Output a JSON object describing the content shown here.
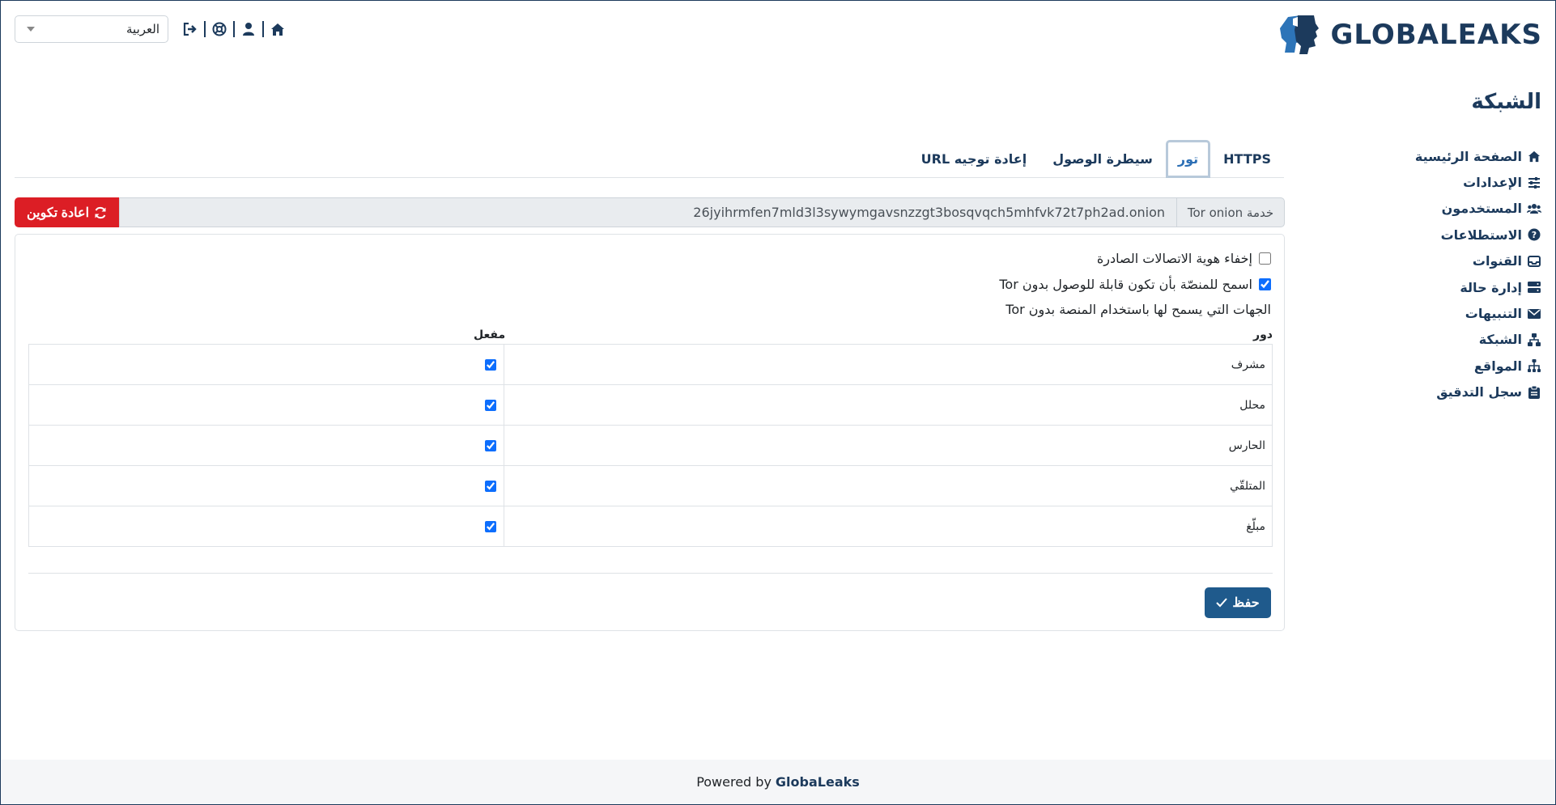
{
  "header": {
    "logo_text": "GLOBALEAKS",
    "language": "العربية",
    "icons": [
      "logout-icon",
      "support-icon",
      "user-icon",
      "home-icon"
    ]
  },
  "page_title": "الشبكة",
  "sidebar": {
    "items": [
      {
        "label": "الصفحة الرئيسية",
        "icon": "home-icon"
      },
      {
        "label": "الإعدادات",
        "icon": "sliders-icon"
      },
      {
        "label": "المستخدمون",
        "icon": "users-icon"
      },
      {
        "label": "الاستطلاعات",
        "icon": "question-icon"
      },
      {
        "label": "القنوات",
        "icon": "inbox-icon"
      },
      {
        "label": "إدارة حالة",
        "icon": "server-icon"
      },
      {
        "label": "التنبيهات",
        "icon": "envelope-icon"
      },
      {
        "label": "الشبكة",
        "icon": "network-icon"
      },
      {
        "label": "المواقع",
        "icon": "sitemap-icon"
      },
      {
        "label": "سجل التدقيق",
        "icon": "clipboard-icon"
      }
    ]
  },
  "tabs": [
    {
      "label": "HTTPS",
      "active": false
    },
    {
      "label": "تور",
      "active": true
    },
    {
      "label": "سيطرة الوصول",
      "active": false
    },
    {
      "label": "إعادة توجيه URL",
      "active": false
    }
  ],
  "onion": {
    "label": "خدمة Tor onion",
    "value": "26jyihrmfen7mld3l3sywymgavsnzzgt3bosqvqch5mhfvk72t7ph2ad.onion",
    "reconfigure_label": "اعادة تكوين"
  },
  "settings": {
    "anonymize_outgoing": {
      "label": "إخفاء هوية الاتصالات الصادرة",
      "checked": false
    },
    "allow_without_tor": {
      "label": "اسمح للمنصّة بأن تكون قابلة للوصول بدون Tor",
      "checked": true
    },
    "allowed_parties_text": "الجهات التي يسمح لها باستخدام المنصة بدون Tor"
  },
  "roles_table": {
    "headers": {
      "role": "دور",
      "enabled": "مفعل"
    },
    "rows": [
      {
        "role": "مشرف",
        "enabled": true
      },
      {
        "role": "محلل",
        "enabled": true
      },
      {
        "role": "الحارس",
        "enabled": true
      },
      {
        "role": "المتلقّي",
        "enabled": true
      },
      {
        "role": "مبلّغ",
        "enabled": true
      }
    ]
  },
  "save_label": "حفظ",
  "footer": {
    "prefix": "Powered by",
    "brand": "GlobaLeaks"
  },
  "colors": {
    "brand": "#1c3a5c",
    "danger": "#dc1e25",
    "primary": "#1f5a8c",
    "active_tab": "#2c6fb5"
  }
}
